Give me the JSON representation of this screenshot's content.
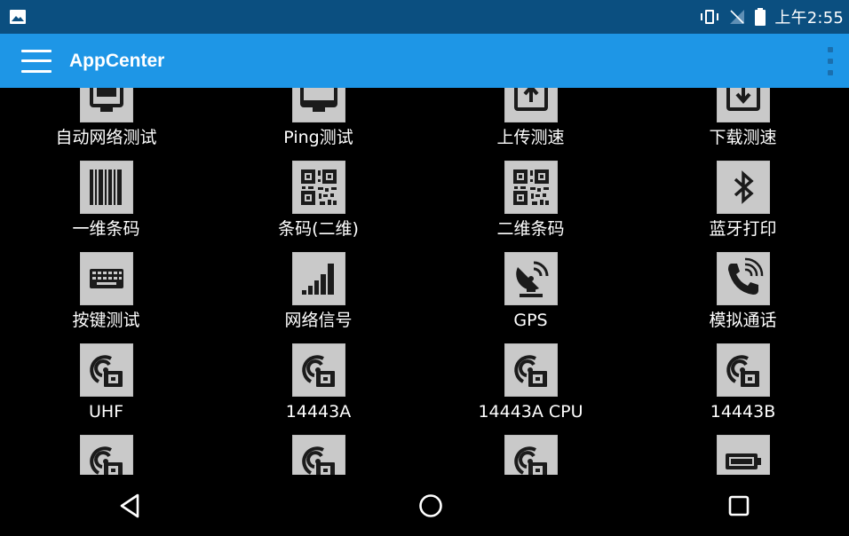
{
  "status_bar": {
    "time": "上午2:55",
    "icons": [
      "image-notification-icon",
      "vibrate-icon",
      "no-signal-icon",
      "battery-icon"
    ]
  },
  "app_bar": {
    "title": "AppCenter",
    "background": "#1e96e6",
    "icons": [
      "hamburger-menu-icon",
      "overflow-menu-icon"
    ]
  },
  "apps": [
    [
      {
        "label": "自动网络测试",
        "icon": "network-test-icon"
      },
      {
        "label": "Ping测试",
        "icon": "ping-test-icon"
      },
      {
        "label": "上传测速",
        "icon": "upload-speed-icon"
      },
      {
        "label": "下载测速",
        "icon": "download-speed-icon"
      }
    ],
    [
      {
        "label": "一维条码",
        "icon": "barcode-icon"
      },
      {
        "label": "条码(二维)",
        "icon": "qrcode-icon"
      },
      {
        "label": "二维条码",
        "icon": "qrcode-icon"
      },
      {
        "label": "蓝牙打印",
        "icon": "bluetooth-icon"
      }
    ],
    [
      {
        "label": "按键测试",
        "icon": "keyboard-icon"
      },
      {
        "label": "网络信号",
        "icon": "signal-bars-icon"
      },
      {
        "label": "GPS",
        "icon": "satellite-dish-icon"
      },
      {
        "label": "模拟通话",
        "icon": "phone-call-icon"
      }
    ],
    [
      {
        "label": "UHF",
        "icon": "nfc-card-icon"
      },
      {
        "label": "14443A",
        "icon": "nfc-card-icon"
      },
      {
        "label": "14443A CPU",
        "icon": "nfc-card-icon"
      },
      {
        "label": "14443B",
        "icon": "nfc-card-icon"
      }
    ],
    [
      {
        "label": "",
        "icon": "nfc-card-icon"
      },
      {
        "label": "",
        "icon": "nfc-card-icon"
      },
      {
        "label": "",
        "icon": "nfc-card-icon"
      },
      {
        "label": "",
        "icon": "battery-icon"
      }
    ]
  ],
  "nav_bar": {
    "icons": [
      "back-icon",
      "home-icon",
      "recents-icon"
    ]
  }
}
